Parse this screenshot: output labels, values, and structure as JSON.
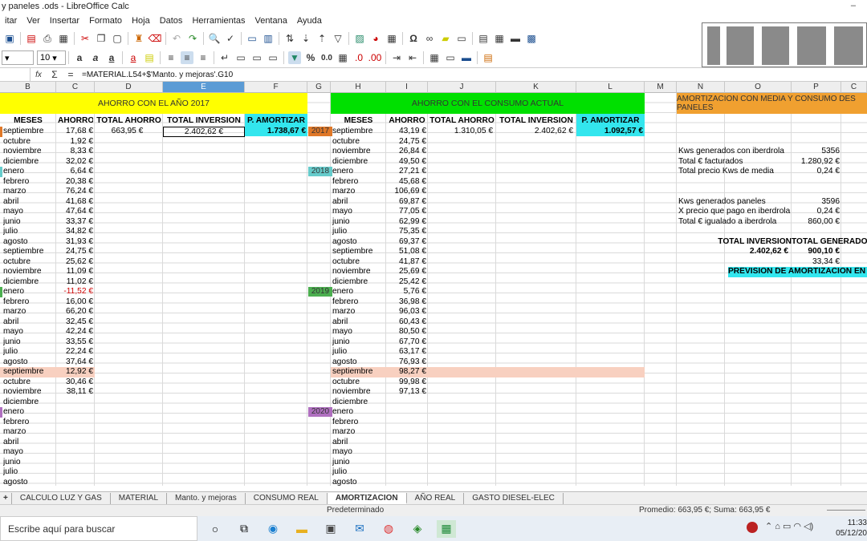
{
  "window": {
    "title": "y paneles .ods - LibreOffice Calc"
  },
  "menu": [
    "itar",
    "Ver",
    "Insertar",
    "Formato",
    "Hoja",
    "Datos",
    "Herramientas",
    "Ventana",
    "Ayuda"
  ],
  "font_size": "10",
  "formula": "=MATERIAL.L54+$'Manto. y mejoras'.G10",
  "columns": [
    {
      "label": "B"
    },
    {
      "label": "C"
    },
    {
      "label": "D"
    },
    {
      "label": "E"
    },
    {
      "label": "F"
    },
    {
      "label": "G"
    },
    {
      "label": "H"
    },
    {
      "label": "I"
    },
    {
      "label": "J"
    },
    {
      "label": "K"
    },
    {
      "label": "L"
    },
    {
      "label": "M"
    },
    {
      "label": "N"
    },
    {
      "label": "O"
    },
    {
      "label": "P"
    },
    {
      "label": "C"
    }
  ],
  "left": {
    "banner": "AHORRO CON EL AÑO 2017",
    "headers": [
      "MESES",
      "AHORRO",
      "TOTAL AHORRO",
      "TOTAL INVERSION",
      "P. AMORTIZAR"
    ],
    "total_ahorro": "663,95 €",
    "total_inversion": "2.402,62 €",
    "p_amortizar": "1.738,67 €",
    "rows": [
      [
        "septiembre",
        "17,68 €"
      ],
      [
        "octubre",
        "1,92 €"
      ],
      [
        "noviembre",
        "8,33 €"
      ],
      [
        "diciembre",
        "32,02 €"
      ],
      [
        "enero",
        "6,64 €"
      ],
      [
        "febrero",
        "20,38 €"
      ],
      [
        "marzo",
        "76,24 €"
      ],
      [
        "abril",
        "41,68 €"
      ],
      [
        "mayo",
        "47,64 €"
      ],
      [
        "junio",
        "33,37 €"
      ],
      [
        "julio",
        "34,82 €"
      ],
      [
        "agosto",
        "31,93 €"
      ],
      [
        "septiembre",
        "24,75 €"
      ],
      [
        "octubre",
        "25,62 €"
      ],
      [
        "noviembre",
        "11,09 €"
      ],
      [
        "diciembre",
        "11,02 €"
      ],
      [
        "enero",
        "-11,52 €"
      ],
      [
        "febrero",
        "16,00 €"
      ],
      [
        "marzo",
        "66,20 €"
      ],
      [
        "abril",
        "32,45 €"
      ],
      [
        "mayo",
        "42,24 €"
      ],
      [
        "junio",
        "33,55 €"
      ],
      [
        "julio",
        "22,24 €"
      ],
      [
        "agosto",
        "37,64 €"
      ],
      [
        "septiembre",
        "12,92 €"
      ],
      [
        "octubre",
        "30,46 €"
      ],
      [
        "noviembre",
        "38,11 €"
      ],
      [
        "diciembre",
        ""
      ],
      [
        "enero",
        ""
      ],
      [
        "febrero",
        ""
      ],
      [
        "marzo",
        ""
      ],
      [
        "abril",
        ""
      ],
      [
        "mayo",
        ""
      ],
      [
        "junio",
        ""
      ],
      [
        "julio",
        ""
      ],
      [
        "agosto",
        ""
      ]
    ]
  },
  "middle": {
    "banner": "AHORRO CON EL CONSUMO ACTUAL",
    "headers": [
      "MESES",
      "AHORRO",
      "TOTAL AHORRO",
      "TOTAL INVERSION",
      "P. AMORTIZAR"
    ],
    "total_ahorro": "1.310,05 €",
    "total_inversion": "2.402,62 €",
    "p_amortizar": "1.092,57 €",
    "years": [
      "2017",
      "2018",
      "2019",
      "2020"
    ],
    "rows": [
      [
        "septiembre",
        "43,19 €"
      ],
      [
        "octubre",
        "24,75 €"
      ],
      [
        "noviembre",
        "26,84 €"
      ],
      [
        "diciembre",
        "49,50 €"
      ],
      [
        "enero",
        "27,21 €"
      ],
      [
        "febrero",
        "45,68 €"
      ],
      [
        "marzo",
        "106,69 €"
      ],
      [
        "abril",
        "69,87 €"
      ],
      [
        "mayo",
        "77,05 €"
      ],
      [
        "junio",
        "62,99 €"
      ],
      [
        "julio",
        "75,35 €"
      ],
      [
        "agosto",
        "69,37 €"
      ],
      [
        "septiembre",
        "51,08 €"
      ],
      [
        "octubre",
        "41,87 €"
      ],
      [
        "noviembre",
        "25,69 €"
      ],
      [
        "diciembre",
        "25,42 €"
      ],
      [
        "enero",
        "5,76 €"
      ],
      [
        "febrero",
        "36,98 €"
      ],
      [
        "marzo",
        "96,03 €"
      ],
      [
        "abril",
        "60,43 €"
      ],
      [
        "mayo",
        "80,50 €"
      ],
      [
        "junio",
        "67,70 €"
      ],
      [
        "julio",
        "63,17 €"
      ],
      [
        "agosto",
        "76,93 €"
      ],
      [
        "septiembre",
        "98,27 €"
      ],
      [
        "octubre",
        "99,98 €"
      ],
      [
        "noviembre",
        "97,13 €"
      ],
      [
        "diciembre",
        ""
      ],
      [
        "enero",
        ""
      ],
      [
        "febrero",
        ""
      ],
      [
        "marzo",
        ""
      ],
      [
        "abril",
        ""
      ],
      [
        "mayo",
        ""
      ],
      [
        "junio",
        ""
      ],
      [
        "julio",
        ""
      ],
      [
        "agosto",
        ""
      ]
    ]
  },
  "right": {
    "banner": "AMORTIZACION CON MEDIA Y CONSUMO DES PANELES",
    "items": [
      [
        "Kws generados con iberdrola",
        "5356"
      ],
      [
        "Total € facturados",
        "1.280,92 €"
      ],
      [
        "Total precio Kws de media",
        "0,24 €"
      ],
      [
        "Kws generados paneles",
        "3596"
      ],
      [
        "X precio que pago en iberdrola",
        "0,24 €"
      ],
      [
        "Total € igualado a iberdrola",
        "860,00 €"
      ]
    ],
    "total_inversion_label": "TOTAL INVERSION",
    "total_generado_label": "TOTAL GENERADO",
    "total_inversion": "2.402,62 €",
    "total_generado": "900,10 €",
    "extra": "33,34 €",
    "prevision": "PREVISION DE AMORTIZACION EN"
  },
  "sheets": [
    "CALCULO LUZ Y GAS",
    "MATERIAL",
    "Manto. y mejoras",
    "CONSUMO REAL",
    "AMORTIZACION",
    "AÑO REAL",
    "GASTO DIESEL-ELEC"
  ],
  "active_sheet": "AMORTIZACION",
  "status": {
    "style": "Predeterminado",
    "summary": "Promedio: 663,95 €; Suma: 663,95 €"
  },
  "taskbar": {
    "search": "Escribe aquí para buscar",
    "time": "11:33",
    "date": "05/12/20"
  },
  "colors": {
    "yellow": "#ffff00",
    "green": "#00e000",
    "orange": "#f0a030",
    "cyan": "#33e6ee",
    "salmon": "#f8d0c0",
    "year2017": "#e07828",
    "year2018": "#66cccc",
    "year2019": "#4caf50",
    "year2020": "#b070c0"
  }
}
